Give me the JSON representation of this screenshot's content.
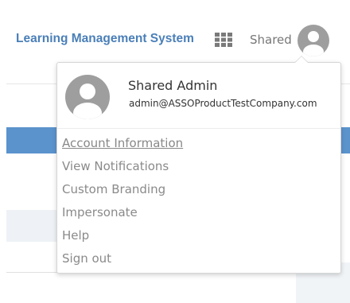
{
  "header": {
    "app_title": "Learning Management System",
    "apps_icon": "grid-apps-icon",
    "user_short_name": "Shared",
    "avatar_icon": "user-avatar-icon"
  },
  "user_menu": {
    "full_name": "Shared Admin",
    "email": "admin@ASSOProductTestCompany.com",
    "avatar_icon": "user-avatar-icon",
    "items": [
      {
        "label": "Account Information",
        "active": true
      },
      {
        "label": "View Notifications"
      },
      {
        "label": "Custom Branding"
      },
      {
        "label": "Impersonate"
      },
      {
        "label": "Help"
      },
      {
        "label": "Sign out"
      }
    ]
  },
  "colors": {
    "brand_blue": "#4a7fb8",
    "bar_blue": "#5b93cd",
    "avatar_gray": "#9e9e9e",
    "menu_text": "#8a8a8a"
  }
}
